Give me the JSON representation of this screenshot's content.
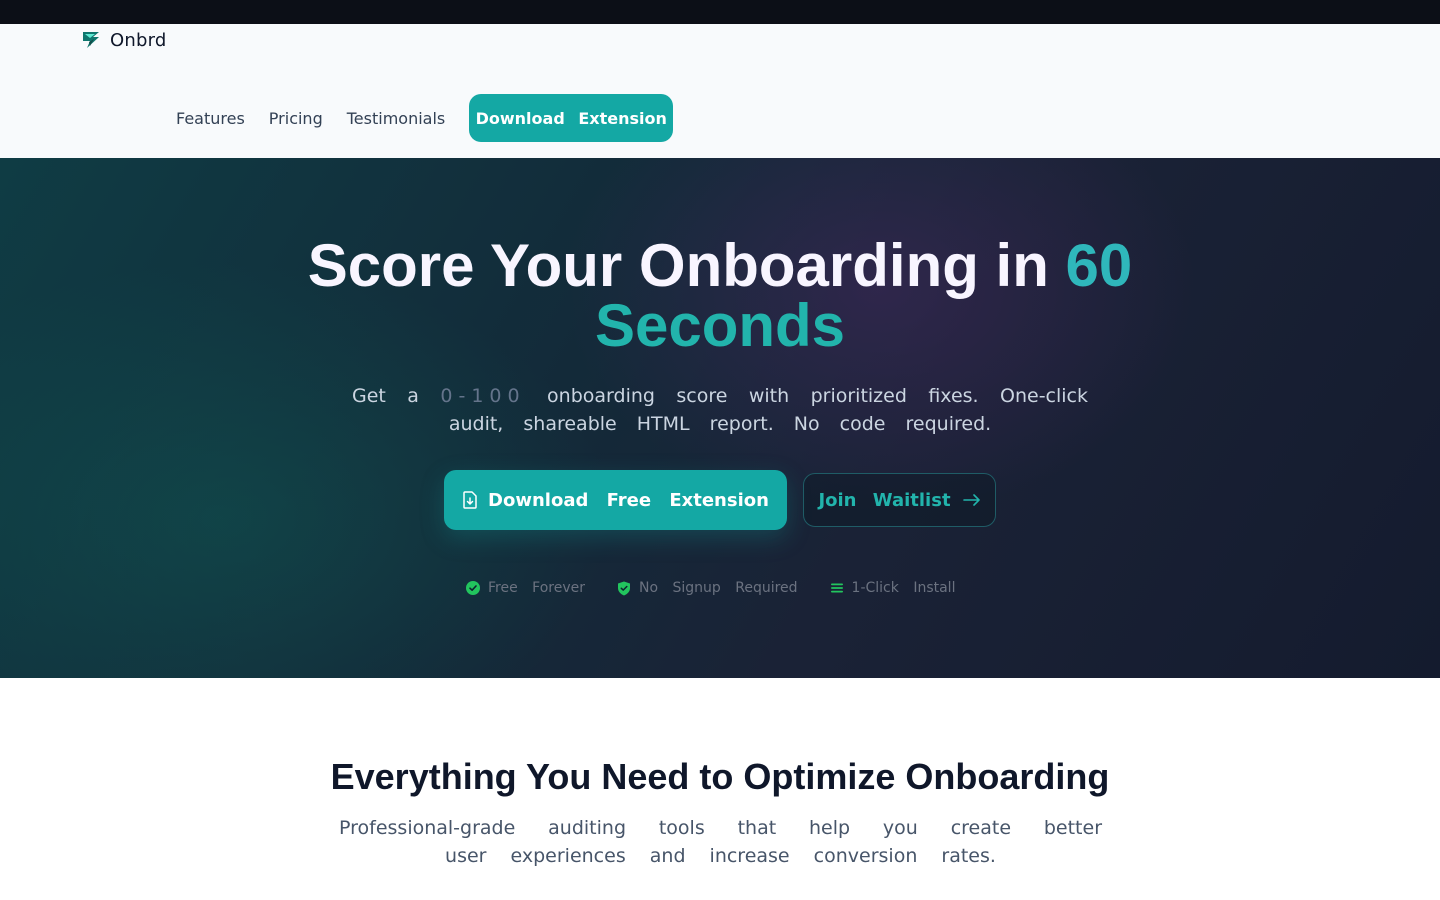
{
  "header": {
    "brand": "Onbrd",
    "nav": [
      "Features",
      "Pricing",
      "Testimonials"
    ],
    "cta_label": "Download Extension"
  },
  "hero": {
    "title_main": "Score Your Onboarding in",
    "title_highlight": "60",
    "title_line2": "Seconds",
    "subtitle_before": "Get a",
    "subtitle_score": "0-100",
    "subtitle_after": "onboarding score with prioritized fixes. One-click audit, shareable HTML report. No code required.",
    "primary_button": "Download Free Extension",
    "secondary_button": "Join Waitlist",
    "trust": [
      {
        "icon": "check-circle-icon",
        "label": "Free Forever"
      },
      {
        "icon": "shield-check-icon",
        "label": "No Signup Required"
      },
      {
        "icon": "lines-icon",
        "label": "1-Click Install"
      }
    ]
  },
  "features": {
    "title": "Everything You Need to Optimize Onboarding",
    "subtitle": "Professional-grade auditing tools that help you create better user experiences and increase conversion rates."
  },
  "colors": {
    "accent": "#14a8a4",
    "trust_icon": "#22c55e",
    "topbar": "#0c0f17"
  }
}
